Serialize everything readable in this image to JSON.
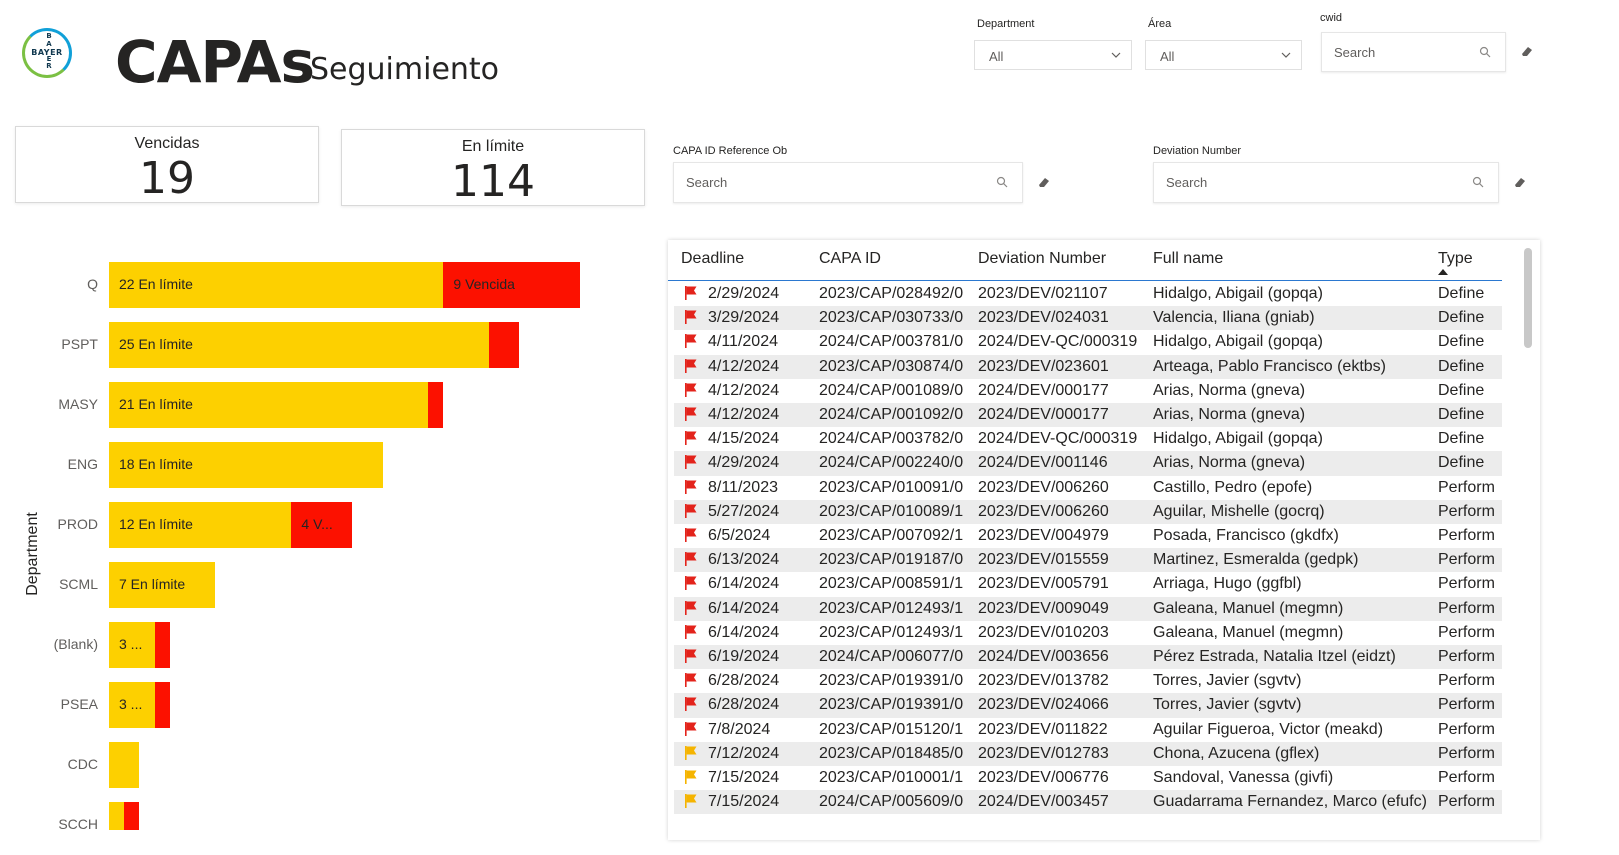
{
  "header": {
    "logo_text": "BAYER",
    "title": "CAPAs",
    "subtitle": "Seguimiento"
  },
  "slicers": {
    "department": {
      "label": "Department",
      "value": "All"
    },
    "area": {
      "label": "Área",
      "value": "All"
    },
    "cwid": {
      "label": "cwid",
      "placeholder": "Search"
    },
    "capa_id": {
      "label": "CAPA ID Reference Ob",
      "placeholder": "Search"
    },
    "deviation": {
      "label": "Deviation Number",
      "placeholder": "Search"
    }
  },
  "kpis": {
    "vencidas": {
      "label": "Vencidas",
      "value": "19"
    },
    "en_limite": {
      "label": "En límite",
      "value": "114"
    }
  },
  "colors": {
    "en_limite": "#fdd000",
    "vencida": "#fc1100",
    "accent": "#2b78d0"
  },
  "chart_data": {
    "type": "bar",
    "orientation": "horizontal",
    "stacked": true,
    "ylabel": "Department",
    "categories": [
      "Q",
      "PSPT",
      "MASY",
      "ENG",
      "PROD",
      "SCML",
      "(Blank)",
      "PSEA",
      "CDC",
      "SCCH"
    ],
    "series": [
      {
        "name": "En límite",
        "values": [
          22,
          25,
          21,
          18,
          12,
          7,
          3,
          3,
          2,
          1
        ]
      },
      {
        "name": "Vencida",
        "values": [
          9,
          2,
          1,
          0,
          4,
          0,
          1,
          1,
          0,
          1
        ]
      }
    ],
    "labels": [
      [
        "22 En límite",
        "9 Vencida"
      ],
      [
        "25 En límite",
        ""
      ],
      [
        "21 En límite",
        ""
      ],
      [
        "18 En límite",
        ""
      ],
      [
        "12 En límite",
        "4 V..."
      ],
      [
        "7 En límite",
        ""
      ],
      [
        "3 ...",
        ""
      ],
      [
        "3 ...",
        ""
      ],
      [
        "",
        ""
      ],
      [
        "",
        ""
      ]
    ],
    "visible_category_labels": [
      "Q",
      "PSPT",
      "MASY",
      "ENG",
      "PROD",
      "SCML",
      "(Blank)",
      "PSEA",
      "CDC",
      "SCCH"
    ]
  },
  "table": {
    "columns": [
      "Deadline",
      "CAPA ID",
      "Deviation Number",
      "Full name",
      "Type"
    ],
    "sorted_by": "Type",
    "rows": [
      {
        "flag": "red",
        "deadline": "2/29/2024",
        "capa": "2023/CAP/028492/0",
        "dev": "2023/DEV/021107",
        "name": "Hidalgo, Abigail (gopqa)",
        "type": "Define"
      },
      {
        "flag": "red",
        "deadline": "3/29/2024",
        "capa": "2023/CAP/030733/0",
        "dev": "2023/DEV/024031",
        "name": "Valencia, Iliana (gniab)",
        "type": "Define"
      },
      {
        "flag": "red",
        "deadline": "4/11/2024",
        "capa": "2024/CAP/003781/0",
        "dev": "2024/DEV-QC/000319",
        "name": "Hidalgo, Abigail (gopqa)",
        "type": "Define"
      },
      {
        "flag": "red",
        "deadline": "4/12/2024",
        "capa": "2023/CAP/030874/0",
        "dev": "2023/DEV/023601",
        "name": "Arteaga, Pablo Francisco (ektbs)",
        "type": "Define"
      },
      {
        "flag": "red",
        "deadline": "4/12/2024",
        "capa": "2024/CAP/001089/0",
        "dev": "2024/DEV/000177",
        "name": "Arias, Norma (gneva)",
        "type": "Define"
      },
      {
        "flag": "red",
        "deadline": "4/12/2024",
        "capa": "2024/CAP/001092/0",
        "dev": "2024/DEV/000177",
        "name": "Arias, Norma (gneva)",
        "type": "Define"
      },
      {
        "flag": "red",
        "deadline": "4/15/2024",
        "capa": "2024/CAP/003782/0",
        "dev": "2024/DEV-QC/000319",
        "name": "Hidalgo, Abigail (gopqa)",
        "type": "Define"
      },
      {
        "flag": "red",
        "deadline": "4/29/2024",
        "capa": "2024/CAP/002240/0",
        "dev": "2024/DEV/001146",
        "name": "Arias, Norma (gneva)",
        "type": "Define"
      },
      {
        "flag": "red",
        "deadline": "8/11/2023",
        "capa": "2023/CAP/010091/0",
        "dev": "2023/DEV/006260",
        "name": "Castillo, Pedro (epofe)",
        "type": "Perform"
      },
      {
        "flag": "red",
        "deadline": "5/27/2024",
        "capa": "2023/CAP/010089/1",
        "dev": "2023/DEV/006260",
        "name": "Aguilar, Mishelle (gocrq)",
        "type": "Perform"
      },
      {
        "flag": "red",
        "deadline": "6/5/2024",
        "capa": "2023/CAP/007092/1",
        "dev": "2023/DEV/004979",
        "name": "Posada, Francisco (gkdfx)",
        "type": "Perform"
      },
      {
        "flag": "red",
        "deadline": "6/13/2024",
        "capa": "2023/CAP/019187/0",
        "dev": "2023/DEV/015559",
        "name": "Martinez, Esmeralda (gedpk)",
        "type": "Perform"
      },
      {
        "flag": "red",
        "deadline": "6/14/2024",
        "capa": "2023/CAP/008591/1",
        "dev": "2023/DEV/005791",
        "name": "Arriaga, Hugo (ggfbl)",
        "type": "Perform"
      },
      {
        "flag": "red",
        "deadline": "6/14/2024",
        "capa": "2023/CAP/012493/1",
        "dev": "2023/DEV/009049",
        "name": "Galeana, Manuel (megmn)",
        "type": "Perform"
      },
      {
        "flag": "red",
        "deadline": "6/14/2024",
        "capa": "2023/CAP/012493/1",
        "dev": "2023/DEV/010203",
        "name": "Galeana, Manuel (megmn)",
        "type": "Perform"
      },
      {
        "flag": "red",
        "deadline": "6/19/2024",
        "capa": "2024/CAP/006077/0",
        "dev": "2024/DEV/003656",
        "name": "Pérez Estrada, Natalia Itzel (eidzt)",
        "type": "Perform"
      },
      {
        "flag": "red",
        "deadline": "6/28/2024",
        "capa": "2023/CAP/019391/0",
        "dev": "2023/DEV/013782",
        "name": "Torres, Javier (sgvtv)",
        "type": "Perform"
      },
      {
        "flag": "red",
        "deadline": "6/28/2024",
        "capa": "2023/CAP/019391/0",
        "dev": "2023/DEV/024066",
        "name": "Torres, Javier (sgvtv)",
        "type": "Perform"
      },
      {
        "flag": "red",
        "deadline": "7/8/2024",
        "capa": "2023/CAP/015120/1",
        "dev": "2023/DEV/011822",
        "name": "Aguilar Figueroa, Victor (meakd)",
        "type": "Perform"
      },
      {
        "flag": "yellow",
        "deadline": "7/12/2024",
        "capa": "2023/CAP/018485/0",
        "dev": "2023/DEV/012783",
        "name": "Chona, Azucena (gflex)",
        "type": "Perform"
      },
      {
        "flag": "yellow",
        "deadline": "7/15/2024",
        "capa": "2023/CAP/010001/1",
        "dev": "2023/DEV/006776",
        "name": "Sandoval, Vanessa (givfi)",
        "type": "Perform"
      },
      {
        "flag": "yellow",
        "deadline": "7/15/2024",
        "capa": "2024/CAP/005609/0",
        "dev": "2024/DEV/003457",
        "name": "Guadarrama Fernandez, Marco (efufc)",
        "type": "Perform"
      }
    ]
  }
}
